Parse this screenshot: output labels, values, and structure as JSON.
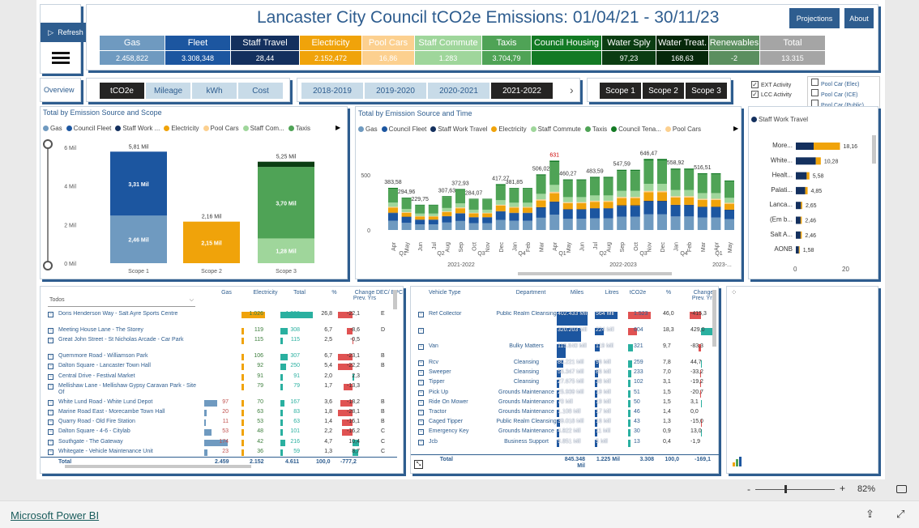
{
  "header": {
    "title": "Lancaster City Council tCO2e Emissions: 01/04/21 - 30/11/23",
    "refresh": "Refresh",
    "projections": "Projections",
    "about": "About",
    "overview": "Overview"
  },
  "kpis": [
    {
      "label": "Gas",
      "value": "2.458,822",
      "bg": "#6f9ac0",
      "vbg": "#6f9ac0"
    },
    {
      "label": "Fleet",
      "value": "3.308,348",
      "bg": "#1c56a0",
      "vbg": "#1c56a0"
    },
    {
      "label": "Staff Travel",
      "value": "28,44",
      "bg": "#14305e",
      "vbg": "#14305e"
    },
    {
      "label": "Electricity",
      "value": "2.152,472",
      "bg": "#f0a30a",
      "vbg": "#f0a30a"
    },
    {
      "label": "Pool Cars",
      "value": "16,86",
      "bg": "#fcd08f",
      "vbg": "#fcd08f"
    },
    {
      "label": "Staff Commute",
      "value": "1.283",
      "bg": "#9fd69b",
      "vbg": "#9fd69b"
    },
    {
      "label": "Taxis",
      "value": "3.704,79",
      "bg": "#4fa356",
      "vbg": "#4fa356"
    },
    {
      "label": "Council Housing",
      "value": "",
      "bg": "#137a24",
      "vbg": "#137a24"
    },
    {
      "label": "Water Sply",
      "value": "97,23",
      "bg": "#0b3d12",
      "vbg": "#0b3d12"
    },
    {
      "label": "Water Treat.",
      "value": "168,63",
      "bg": "#06280a",
      "vbg": "#06280a"
    },
    {
      "label": "Renewables",
      "value": "-2",
      "bg": "#5b8f5f",
      "vbg": "#5b8f5f"
    },
    {
      "label": "Total",
      "value": "13.315",
      "bg": "#a5a5a5",
      "vbg": "#a5a5a5"
    }
  ],
  "measures": [
    "tCO2e",
    "Mileage",
    "kWh",
    "Cost"
  ],
  "years": [
    "2018-2019",
    "2019-2020",
    "2020-2021",
    "2021-2022"
  ],
  "scopes": [
    "Scope 1",
    "Scope 2",
    "Scope 3"
  ],
  "activity": [
    "EXT Activity",
    "LCC Activity"
  ],
  "pool_filters": [
    "Pool Car (Elec)",
    "Pool Car (ICE)",
    "Pool Car (Public)",
    "Staff Work Travel"
  ],
  "colors": {
    "gas": "#6f9ac0",
    "fleet": "#1c56a0",
    "staff": "#14305e",
    "elec": "#f0a30a",
    "pool": "#fcd08f",
    "commute": "#9fd69b",
    "taxis": "#4fa356",
    "housing": "#137a24",
    "dark": "#0b3d12"
  },
  "chart_data": [
    {
      "type": "bar",
      "title": "Total by Emission Source and Scope",
      "legend": [
        "Gas",
        "Council Fleet",
        "Staff Work ...",
        "Electricity",
        "Pool Cars",
        "Staff Com...",
        "Taxis"
      ],
      "categories": [
        "Scope 1",
        "Scope 2",
        "Scope 3"
      ],
      "y_ticks": [
        "6 Mil",
        "4 Mil",
        "2 Mil",
        "0 Mil"
      ],
      "totals": [
        "5,81 Mil",
        "2,16 Mil",
        "5,25 Mil"
      ],
      "series": [
        {
          "name": "Gas",
          "values": [
            2.46,
            0,
            0
          ],
          "label": "2,46 Mil"
        },
        {
          "name": "Council Fleet",
          "values": [
            3.31,
            0,
            0
          ],
          "label": "3,31 Mil"
        },
        {
          "name": "Electricity",
          "values": [
            0,
            2.15,
            0
          ],
          "label": "2,15 Mil"
        },
        {
          "name": "Staff Com...",
          "values": [
            0,
            0,
            1.28
          ],
          "label": "1,28 Mil"
        },
        {
          "name": "Taxis",
          "values": [
            0,
            0,
            3.7
          ],
          "label": "3,70 Mil"
        }
      ],
      "ylim": [
        0,
        6.2
      ]
    },
    {
      "type": "bar",
      "title": "Total by Emission Source and Time",
      "legend": [
        "Gas",
        "Council Fleet",
        "Staff Work Travel",
        "Electricity",
        "Staff Commute",
        "Taxis",
        "Council Tena...",
        "Pool Cars"
      ],
      "y_ticks": [
        "500",
        "0"
      ],
      "months": [
        "Apr",
        "May",
        "Jun",
        "Jul",
        "Aug",
        "Sep",
        "Oct",
        "Nov",
        "Dec",
        "Jan",
        "Feb",
        "Mar",
        "Apr",
        "May",
        "Jun",
        "Jul",
        "Aug",
        "Sep",
        "Oct",
        "Nov",
        "Dec",
        "Jan",
        "Feb",
        "Mar",
        "Apr",
        "May"
      ],
      "quarters": [
        "Q1",
        "Q2",
        "Q3",
        "Q4",
        "Q1",
        "Q2",
        "Q3",
        "Q4",
        "Q1"
      ],
      "years": [
        "2021-2022",
        "2022-2023",
        "2023-..."
      ],
      "totals": [
        383.58,
        294.96,
        229.75,
        307.63,
        372.93,
        284.07,
        417.27,
        381.85,
        506.02,
        631,
        460.27,
        483.59,
        547.59,
        646.47,
        558.92,
        516.51
      ],
      "total_labels": [
        "383,58",
        "294,96",
        "229,75",
        "307,63",
        "372,93",
        "284,07",
        "417,27",
        "381,85",
        "506,02",
        "631",
        "460,27",
        "483,59",
        "547,59",
        "646,47",
        "558,92",
        "516,51"
      ],
      "ylim": [
        0,
        700
      ]
    },
    {
      "type": "bar",
      "title": "Staff Work Travel",
      "categories": [
        "More...",
        "White...",
        "Healt...",
        "Palati...",
        "Lanca...",
        "(Em b...",
        "Salt A...",
        "AONB"
      ],
      "values": [
        18.16,
        10.28,
        5.58,
        4.85,
        2.65,
        2.46,
        2.46,
        1.58
      ],
      "value_labels": [
        "18,16",
        "10,28",
        "5,58",
        "4,85",
        "2,65",
        "2,46",
        "2,46",
        "1,58"
      ],
      "x_ticks": [
        "0",
        "20"
      ]
    }
  ],
  "buildings": {
    "filter": "Todos",
    "columns": [
      "Gas",
      "Electricity",
      "Total",
      "%",
      "Change Prev. Yrs",
      "DEC/ EPC"
    ],
    "rows": [
      [
        "Doris Henderson Way - Salt Ayre Sports Centre",
        "",
        "1.026",
        "1.390",
        "26,8",
        "-22,1",
        "E"
      ],
      [
        "Meeting House Lane - The Storey",
        "",
        "119",
        "308",
        "6,7",
        "-8,6",
        "D"
      ],
      [
        "Great John Street - St Nicholas Arcade - Car Park",
        "",
        "115",
        "115",
        "2,5",
        "-0,5",
        ""
      ],
      [
        "Quernmore Road - Williamson Park",
        "",
        "106",
        "307",
        "6,7",
        "-23,1",
        "B"
      ],
      [
        "Dalton Square - Lancaster Town Hall",
        "",
        "92",
        "250",
        "5,4",
        "-22,2",
        "B"
      ],
      [
        "Central Drive - Festival Market",
        "",
        "91",
        "91",
        "2,0",
        "2,3",
        ""
      ],
      [
        "Mellishaw Lane - Mellishaw Gypsy Caravan Park - Site Of",
        "",
        "79",
        "79",
        "1,7",
        "-13,3",
        ""
      ],
      [
        "White Lund Road - White Lund Depot",
        "97",
        "70",
        "167",
        "3,6",
        "-18,2",
        "B"
      ],
      [
        "Marine Road East - Morecambe Town Hall",
        "20",
        "63",
        "83",
        "1,8",
        "-28,1",
        "B"
      ],
      [
        "Quarry Road - Old Fire Station",
        "11",
        "53",
        "63",
        "1,4",
        "-16,1",
        "B"
      ],
      [
        "Dalton Square - 4-6 - Citylab",
        "53",
        "48",
        "101",
        "2,2",
        "-16,2",
        "C"
      ],
      [
        "Southgate - The Gateway",
        "174",
        "42",
        "216",
        "4,7",
        "10,4",
        "C"
      ],
      [
        "Whitegate - Vehicle Maintenance Unit",
        "23",
        "36",
        "59",
        "1,3",
        "8,7",
        "C"
      ]
    ],
    "total": [
      "Total",
      "2.459",
      "2.152",
      "4.611",
      "100,0",
      "-777,2"
    ]
  },
  "vehicles": {
    "columns": [
      "Vehicle Type",
      "Department",
      "Miles",
      "Litres",
      "tCO2e",
      "%",
      "Change Prev. Yrs"
    ],
    "rows": [
      [
        "Ref Collector",
        "Public Realm Cleansing",
        "402.433 Mil",
        "564 Mil",
        "1.523",
        "46,0",
        "-415,3"
      ],
      [
        "",
        "",
        "320.203 Mil",
        "224 Mil",
        "604",
        "18,3",
        "429,0"
      ],
      [
        "Van",
        "Bulky Matters",
        "115.640 Mil",
        "119 Mil",
        "321",
        "9,7",
        "-83,3"
      ],
      [
        "Rcv",
        "Cleansing",
        "80.221 Mil",
        "96 Mil",
        "259",
        "7,8",
        "44,7"
      ],
      [
        "Sweeper",
        "Cleansing",
        "55.347 Mil",
        "86 Mil",
        "233",
        "7,0",
        "-33,2"
      ],
      [
        "Tipper",
        "Cleansing",
        "27.675 Mil",
        "38 Mil",
        "102",
        "3,1",
        "-19,2"
      ],
      [
        "Pick Up",
        "Grounds Maintenance",
        "25.939 Mil",
        "19 Mil",
        "51",
        "1,5",
        "-20,7"
      ],
      [
        "Ride On Mower",
        "Grounds Maintenance",
        "70 Mil",
        "19 Mil",
        "50",
        "1,5",
        "3,1"
      ],
      [
        "Tractor",
        "Grounds Maintenance",
        "1.108 Mil",
        "17 Mil",
        "46",
        "1,4",
        "0,0"
      ],
      [
        "Caged Tipper",
        "Public Realm Cleansing",
        "39.018 Mil",
        "16 Mil",
        "43",
        "1,3",
        "-15,0"
      ],
      [
        "Emergency Key",
        "Grounds Maintenance",
        "4.822 Mil",
        "11 Mil",
        "30",
        "0,9",
        "13,0"
      ],
      [
        "Jcb",
        "Business Support",
        "9.851 Mil",
        "5 Mil",
        "13",
        "0,4",
        "-1,9"
      ]
    ],
    "total": [
      "Total",
      "845.348 Mil",
      "1.225 Mil",
      "3.308",
      "100,0",
      "-169,1"
    ]
  },
  "footer": {
    "brand": "Microsoft Power BI",
    "zoom": "82%",
    "minus": "-",
    "plus": "+"
  }
}
